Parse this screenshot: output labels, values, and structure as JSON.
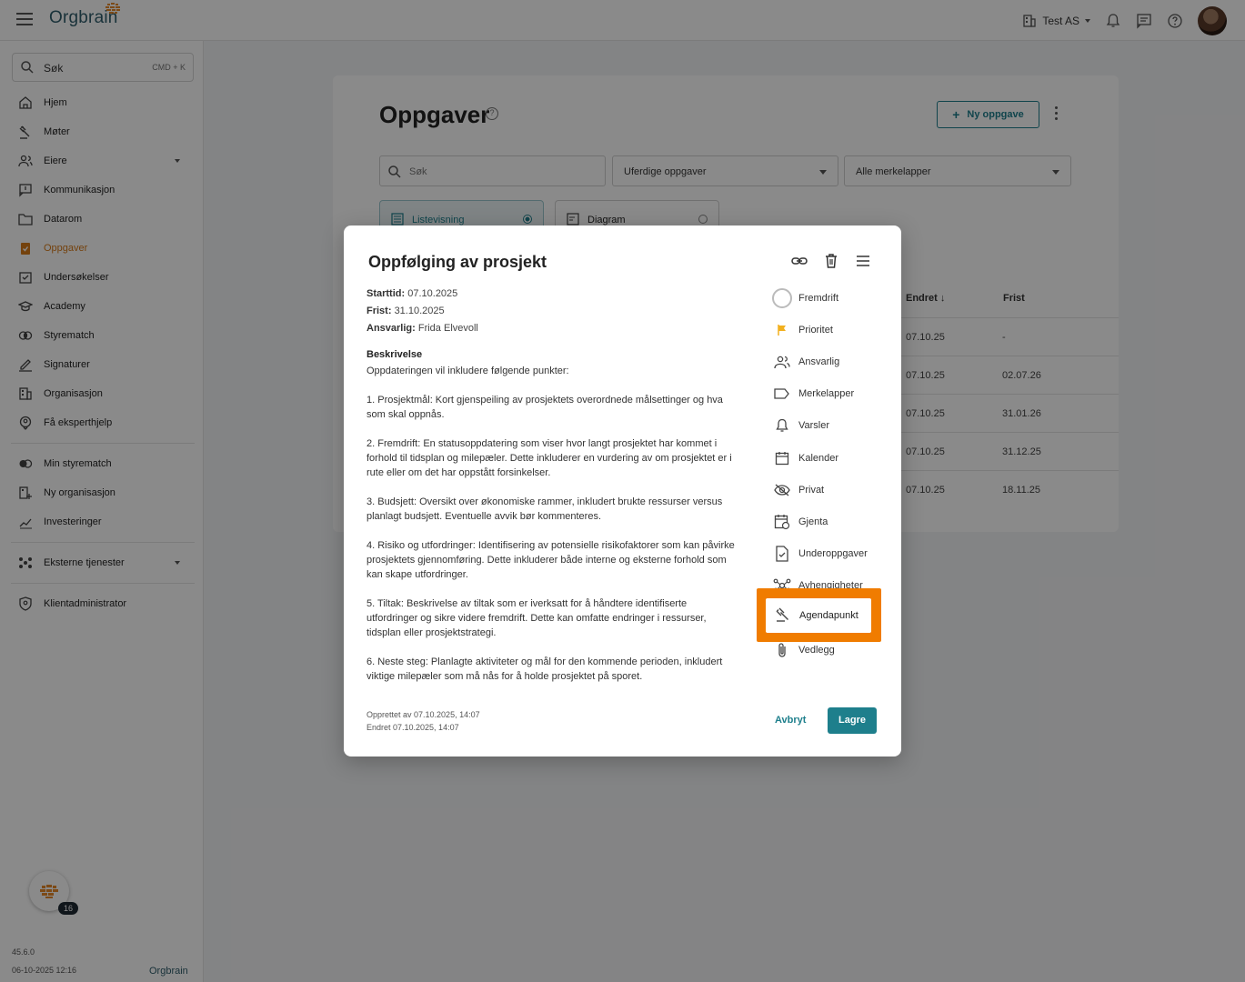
{
  "app": {
    "brand": "Orgbrain",
    "org_name": "Test AS",
    "version": "45.6.0",
    "build_date": "06-10-2025 12:16",
    "chat_badge": "16"
  },
  "search": {
    "label": "Søk",
    "shortcut": "CMD + K"
  },
  "sidebar": {
    "items": [
      {
        "label": "Hjem",
        "icon": "home-icon"
      },
      {
        "label": "Møter",
        "icon": "gavel-icon"
      },
      {
        "label": "Eiere",
        "icon": "people-icon"
      },
      {
        "label": "Kommunikasjon",
        "icon": "chat-icon"
      },
      {
        "label": "Datarom",
        "icon": "folder-icon"
      },
      {
        "label": "Oppgaver",
        "icon": "task-icon"
      },
      {
        "label": "Undersøkelser",
        "icon": "survey-icon"
      },
      {
        "label": "Academy",
        "icon": "academy-icon"
      },
      {
        "label": "Styrematch",
        "icon": "match-icon"
      },
      {
        "label": "Signaturer",
        "icon": "signature-icon"
      },
      {
        "label": "Organisasjon",
        "icon": "building-icon"
      },
      {
        "label": "Få eksperthjelp",
        "icon": "expert-icon"
      }
    ],
    "items2": [
      {
        "label": "Min styrematch",
        "icon": "match-icon"
      },
      {
        "label": "Ny organisasjon",
        "icon": "building-add-icon"
      },
      {
        "label": "Investeringer",
        "icon": "chart-icon"
      }
    ],
    "items3": [
      {
        "label": "Eksterne tjenester",
        "icon": "services-icon"
      }
    ],
    "items4": [
      {
        "label": "Klientadministrator",
        "icon": "shield-icon"
      }
    ]
  },
  "page": {
    "title": "Oppgaver",
    "new_button": "Ny oppgave",
    "search_placeholder": "Søk",
    "filter_status": "Uferdige oppgaver",
    "filter_tags": "Alle merkelapper",
    "view_list": "Listevisning",
    "view_diagram": "Diagram",
    "col_changed": "Endret",
    "col_due": "Frist",
    "rows": [
      {
        "changed": "07.10.25",
        "due": "-"
      },
      {
        "changed": "07.10.25",
        "due": "02.07.26"
      },
      {
        "changed": "07.10.25",
        "due": "31.01.26"
      },
      {
        "changed": "07.10.25",
        "due": "31.12.25"
      },
      {
        "changed": "07.10.25",
        "due": "18.11.25"
      }
    ]
  },
  "modal": {
    "title": "Oppfølging av prosjekt",
    "start_label": "Starttid:",
    "start_value": "07.10.2025",
    "due_label": "Frist:",
    "due_value": "31.10.2025",
    "resp_label": "Ansvarlig:",
    "resp_value": "Frida Elvevoll",
    "desc_title": "Beskrivelse",
    "desc_intro": "Oppdateringen vil inkludere følgende punkter:",
    "desc_points": [
      "1. Prosjektmål: Kort gjenspeiling av prosjektets overordnede målsettinger og hva som skal oppnås.",
      "2. Fremdrift: En statusoppdatering som viser hvor langt prosjektet har kommet i forhold til tidsplan og milepæler. Dette inkluderer en vurdering av om prosjektet er i rute eller om det har oppstått forsinkelser.",
      "3. Budsjett: Oversikt over økonomiske rammer, inkludert brukte ressurser versus planlagt budsjett. Eventuelle avvik bør kommenteres.",
      "4. Risiko og utfordringer: Identifisering av potensielle risikofaktorer som kan påvirke prosjektets gjennomføring. Dette inkluderer både interne og eksterne forhold som kan skape utfordringer.",
      "5. Tiltak: Beskrivelse av tiltak som er iverksatt for å håndtere identifiserte utfordringer og sikre videre fremdrift. Dette kan omfatte endringer i ressurser, tidsplan eller prosjektstrategi.",
      "6. Neste steg: Planlagte aktiviteter og mål for den kommende perioden, inkludert viktige milepæler som må nås for å holde prosjektet på sporet."
    ],
    "props": [
      {
        "label": "Fremdrift",
        "icon": "progress-circle-icon"
      },
      {
        "label": "Prioritet",
        "icon": "flag-icon"
      },
      {
        "label": "Ansvarlig",
        "icon": "people-icon"
      },
      {
        "label": "Merkelapper",
        "icon": "label-icon"
      },
      {
        "label": "Varsler",
        "icon": "bell-icon"
      },
      {
        "label": "Kalender",
        "icon": "calendar-icon"
      },
      {
        "label": "Privat",
        "icon": "eye-off-icon"
      },
      {
        "label": "Gjenta",
        "icon": "repeat-icon"
      },
      {
        "label": "Underoppgaver",
        "icon": "subtask-icon"
      },
      {
        "label": "Avhengigheter",
        "icon": "dependency-icon"
      },
      {
        "label": "Agendapunkt",
        "icon": "gavel-icon"
      },
      {
        "label": "Vedlegg",
        "icon": "paperclip-icon"
      }
    ],
    "created": "Opprettet av 07.10.2025, 14:07",
    "changed": "Endret 07.10.2025, 14:07",
    "cancel": "Avbryt",
    "save": "Lagre"
  },
  "colors": {
    "accent": "#1e7f8c",
    "active_nav": "#d67a19",
    "highlight": "#f07c00",
    "flag": "#f2b01e"
  }
}
